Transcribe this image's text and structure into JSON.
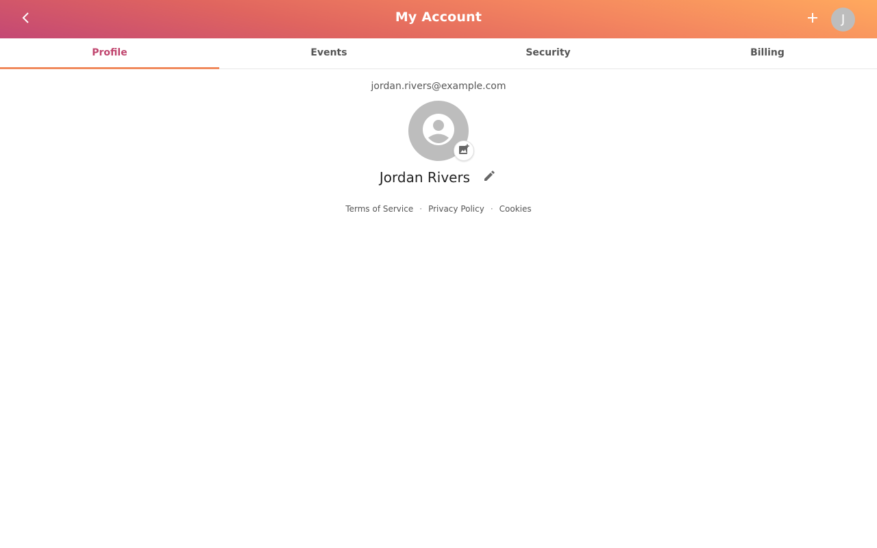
{
  "header": {
    "title": "My Account",
    "back_icon": "chevron-left-icon",
    "add_icon": "plus-icon",
    "avatar_initial": "J",
    "gradient_colors": [
      "#c44874",
      "#ffa95e"
    ]
  },
  "tabs": [
    {
      "label": "Profile",
      "active": true
    },
    {
      "label": "Events",
      "active": false
    },
    {
      "label": "Security",
      "active": false
    },
    {
      "label": "Billing",
      "active": false
    }
  ],
  "profile": {
    "email": "jordan.rivers@example.com",
    "name": "Jordan Rivers",
    "photo_icon": "account-circle-icon",
    "add_photo_icon": "add-photo-icon",
    "edit_icon": "pencil-icon"
  },
  "footer": {
    "links": [
      "Terms of Service",
      "Privacy Policy",
      "Cookies"
    ],
    "separator": "·"
  },
  "colors": {
    "accent": "#c0456e",
    "tab_indicator": "#f08a5d"
  }
}
